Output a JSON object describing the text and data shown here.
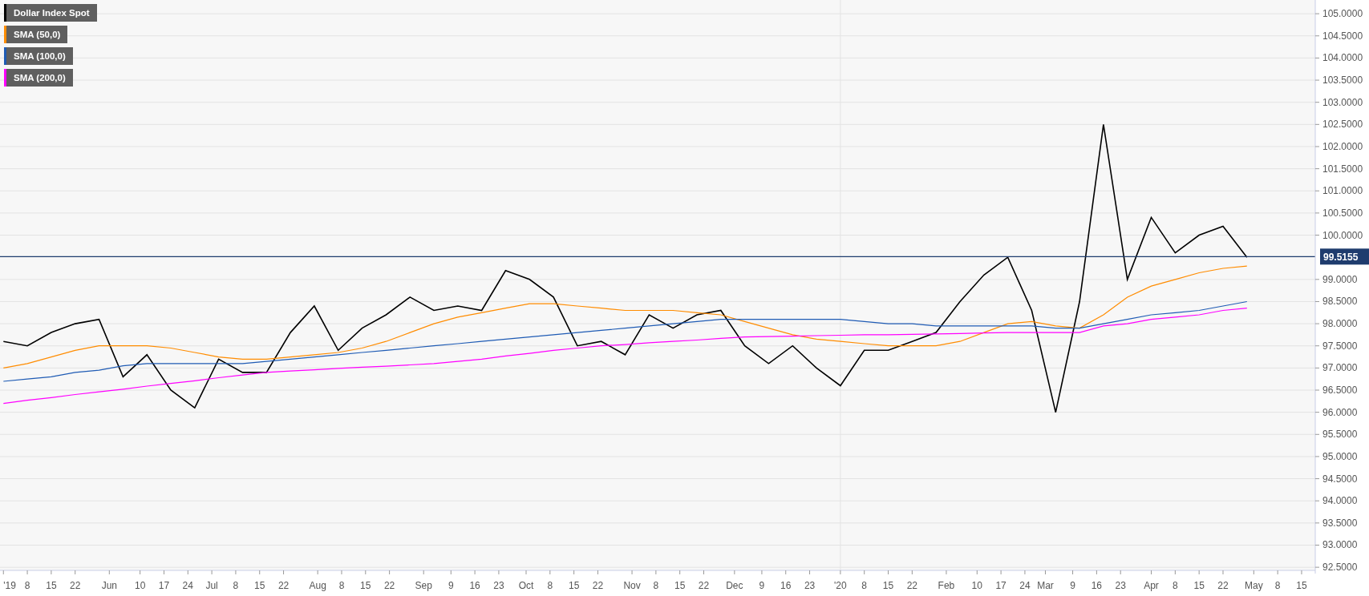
{
  "chart_data": {
    "type": "line",
    "grid": true,
    "ref_lines": [
      {
        "axis": "y",
        "value": 99.5155,
        "label": "99.5155",
        "color": "#1f3c6e"
      }
    ],
    "x": [
      "2019-05-01",
      "2019-05-08",
      "2019-05-15",
      "2019-05-22",
      "2019-05-29",
      "2019-06-05",
      "2019-06-12",
      "2019-06-19",
      "2019-06-26",
      "2019-07-03",
      "2019-07-10",
      "2019-07-17",
      "2019-07-24",
      "2019-07-31",
      "2019-08-07",
      "2019-08-14",
      "2019-08-21",
      "2019-08-28",
      "2019-09-04",
      "2019-09-11",
      "2019-09-18",
      "2019-09-25",
      "2019-10-02",
      "2019-10-09",
      "2019-10-16",
      "2019-10-23",
      "2019-10-30",
      "2019-11-06",
      "2019-11-13",
      "2019-11-20",
      "2019-11-27",
      "2019-12-04",
      "2019-12-11",
      "2019-12-18",
      "2019-12-25",
      "2020-01-01",
      "2020-01-08",
      "2020-01-15",
      "2020-01-22",
      "2020-01-29",
      "2020-02-05",
      "2020-02-12",
      "2020-02-19",
      "2020-02-26",
      "2020-03-04",
      "2020-03-11",
      "2020-03-18",
      "2020-03-25",
      "2020-04-01",
      "2020-04-08",
      "2020-04-15",
      "2020-04-22",
      "2020-04-29"
    ],
    "series": [
      {
        "name": "Dollar Index Spot",
        "color": "#000000",
        "values": [
          97.6,
          97.5,
          97.8,
          98.0,
          98.1,
          96.8,
          97.3,
          96.5,
          96.1,
          97.2,
          96.9,
          96.9,
          97.8,
          98.4,
          97.4,
          97.9,
          98.2,
          98.6,
          98.3,
          98.4,
          98.3,
          99.2,
          99.0,
          98.6,
          97.5,
          97.6,
          97.3,
          98.2,
          97.9,
          98.2,
          98.3,
          97.5,
          97.1,
          97.5,
          97.0,
          96.6,
          97.4,
          97.4,
          97.6,
          97.8,
          98.5,
          99.1,
          99.5,
          98.3,
          96.0,
          98.5,
          102.5,
          99.0,
          100.4,
          99.6,
          100.0,
          100.2,
          99.5
        ]
      },
      {
        "name": "SMA (50,0)",
        "color": "#ff8c00",
        "values": [
          97.0,
          97.1,
          97.25,
          97.4,
          97.5,
          97.5,
          97.5,
          97.45,
          97.35,
          97.25,
          97.2,
          97.2,
          97.25,
          97.3,
          97.35,
          97.45,
          97.6,
          97.8,
          98.0,
          98.15,
          98.25,
          98.35,
          98.45,
          98.45,
          98.4,
          98.35,
          98.3,
          98.3,
          98.3,
          98.25,
          98.2,
          98.05,
          97.9,
          97.75,
          97.65,
          97.6,
          97.55,
          97.5,
          97.5,
          97.5,
          97.6,
          97.8,
          98.0,
          98.05,
          97.95,
          97.9,
          98.2,
          98.6,
          98.85,
          99.0,
          99.15,
          99.25,
          99.3
        ]
      },
      {
        "name": "SMA (100,0)",
        "color": "#1f5bb4",
        "values": [
          96.7,
          96.75,
          96.8,
          96.9,
          96.95,
          97.05,
          97.1,
          97.1,
          97.1,
          97.1,
          97.1,
          97.15,
          97.2,
          97.25,
          97.3,
          97.35,
          97.4,
          97.45,
          97.5,
          97.55,
          97.6,
          97.65,
          97.7,
          97.75,
          97.8,
          97.85,
          97.9,
          97.95,
          98.0,
          98.05,
          98.1,
          98.1,
          98.1,
          98.1,
          98.1,
          98.1,
          98.05,
          98.0,
          98.0,
          97.95,
          97.95,
          97.95,
          97.95,
          97.95,
          97.9,
          97.9,
          98.0,
          98.1,
          98.2,
          98.25,
          98.3,
          98.4,
          98.5
        ]
      },
      {
        "name": "SMA (200,0)",
        "color": "#ff00ff",
        "values": [
          96.2,
          96.27,
          96.33,
          96.4,
          96.46,
          96.52,
          96.59,
          96.65,
          96.71,
          96.78,
          96.84,
          96.9,
          96.93,
          96.96,
          96.99,
          97.02,
          97.04,
          97.07,
          97.1,
          97.15,
          97.2,
          97.27,
          97.33,
          97.4,
          97.45,
          97.5,
          97.53,
          97.57,
          97.6,
          97.63,
          97.67,
          97.7,
          97.71,
          97.72,
          97.73,
          97.74,
          97.75,
          97.75,
          97.76,
          97.77,
          97.78,
          97.79,
          97.8,
          97.8,
          97.8,
          97.8,
          97.95,
          98.0,
          98.1,
          98.15,
          98.2,
          98.3,
          98.35
        ]
      }
    ],
    "xlim": [
      "2019-04-30",
      "2020-05-19"
    ],
    "ylim": [
      92.43,
      105.31
    ],
    "xticks": [
      {
        "value": "2019-05-01",
        "label": "'19"
      },
      {
        "value": "2019-05-08",
        "label": "8"
      },
      {
        "value": "2019-05-15",
        "label": "15"
      },
      {
        "value": "2019-05-22",
        "label": "22"
      },
      {
        "value": "2019-06-01",
        "label": "Jun"
      },
      {
        "value": "2019-06-10",
        "label": "10"
      },
      {
        "value": "2019-06-17",
        "label": "17"
      },
      {
        "value": "2019-06-24",
        "label": "24"
      },
      {
        "value": "2019-07-01",
        "label": "Jul"
      },
      {
        "value": "2019-07-08",
        "label": "8"
      },
      {
        "value": "2019-07-15",
        "label": "15"
      },
      {
        "value": "2019-07-22",
        "label": "22"
      },
      {
        "value": "2019-08-01",
        "label": "Aug"
      },
      {
        "value": "2019-08-08",
        "label": "8"
      },
      {
        "value": "2019-08-15",
        "label": "15"
      },
      {
        "value": "2019-08-22",
        "label": "22"
      },
      {
        "value": "2019-09-01",
        "label": "Sep"
      },
      {
        "value": "2019-09-09",
        "label": "9"
      },
      {
        "value": "2019-09-16",
        "label": "16"
      },
      {
        "value": "2019-09-23",
        "label": "23"
      },
      {
        "value": "2019-10-01",
        "label": "Oct"
      },
      {
        "value": "2019-10-08",
        "label": "8"
      },
      {
        "value": "2019-10-15",
        "label": "15"
      },
      {
        "value": "2019-10-22",
        "label": "22"
      },
      {
        "value": "2019-11-01",
        "label": "Nov"
      },
      {
        "value": "2019-11-08",
        "label": "8"
      },
      {
        "value": "2019-11-15",
        "label": "15"
      },
      {
        "value": "2019-11-22",
        "label": "22"
      },
      {
        "value": "2019-12-01",
        "label": "Dec"
      },
      {
        "value": "2019-12-09",
        "label": "9"
      },
      {
        "value": "2019-12-16",
        "label": "16"
      },
      {
        "value": "2019-12-23",
        "label": "23"
      },
      {
        "value": "2020-01-01",
        "label": "'20"
      },
      {
        "value": "2020-01-08",
        "label": "8"
      },
      {
        "value": "2020-01-15",
        "label": "15"
      },
      {
        "value": "2020-01-22",
        "label": "22"
      },
      {
        "value": "2020-02-01",
        "label": "Feb"
      },
      {
        "value": "2020-02-10",
        "label": "10"
      },
      {
        "value": "2020-02-17",
        "label": "17"
      },
      {
        "value": "2020-02-24",
        "label": "24"
      },
      {
        "value": "2020-03-01",
        "label": "Mar"
      },
      {
        "value": "2020-03-09",
        "label": "9"
      },
      {
        "value": "2020-03-16",
        "label": "16"
      },
      {
        "value": "2020-03-23",
        "label": "23"
      },
      {
        "value": "2020-04-01",
        "label": "Apr"
      },
      {
        "value": "2020-04-08",
        "label": "8"
      },
      {
        "value": "2020-04-15",
        "label": "15"
      },
      {
        "value": "2020-04-22",
        "label": "22"
      },
      {
        "value": "2020-05-01",
        "label": "May"
      },
      {
        "value": "2020-05-08",
        "label": "8"
      },
      {
        "value": "2020-05-15",
        "label": "15"
      }
    ],
    "yticks": [
      {
        "value": 92.5,
        "label": "92.5000"
      },
      {
        "value": 93,
        "label": "93.0000"
      },
      {
        "value": 93.5,
        "label": "93.5000"
      },
      {
        "value": 94,
        "label": "94.0000"
      },
      {
        "value": 94.5,
        "label": "94.5000"
      },
      {
        "value": 95,
        "label": "95.0000"
      },
      {
        "value": 95.5,
        "label": "95.5000"
      },
      {
        "value": 96,
        "label": "96.0000"
      },
      {
        "value": 96.5,
        "label": "96.5000"
      },
      {
        "value": 97,
        "label": "97.0000"
      },
      {
        "value": 97.5,
        "label": "97.5000"
      },
      {
        "value": 98,
        "label": "98.0000"
      },
      {
        "value": 98.5,
        "label": "98.5000"
      },
      {
        "value": 99,
        "label": "99.0000"
      },
      {
        "value": 100,
        "label": "100.0000"
      },
      {
        "value": 100.5,
        "label": "100.5000"
      },
      {
        "value": 101,
        "label": "101.0000"
      },
      {
        "value": 101.5,
        "label": "101.5000"
      },
      {
        "value": 102,
        "label": "102.0000"
      },
      {
        "value": 102.5,
        "label": "102.5000"
      },
      {
        "value": 103,
        "label": "103.0000"
      },
      {
        "value": 103.5,
        "label": "103.5000"
      },
      {
        "value": 104,
        "label": "104.0000"
      },
      {
        "value": 104.5,
        "label": "104.5000"
      },
      {
        "value": 105,
        "label": "105.0000"
      }
    ]
  }
}
